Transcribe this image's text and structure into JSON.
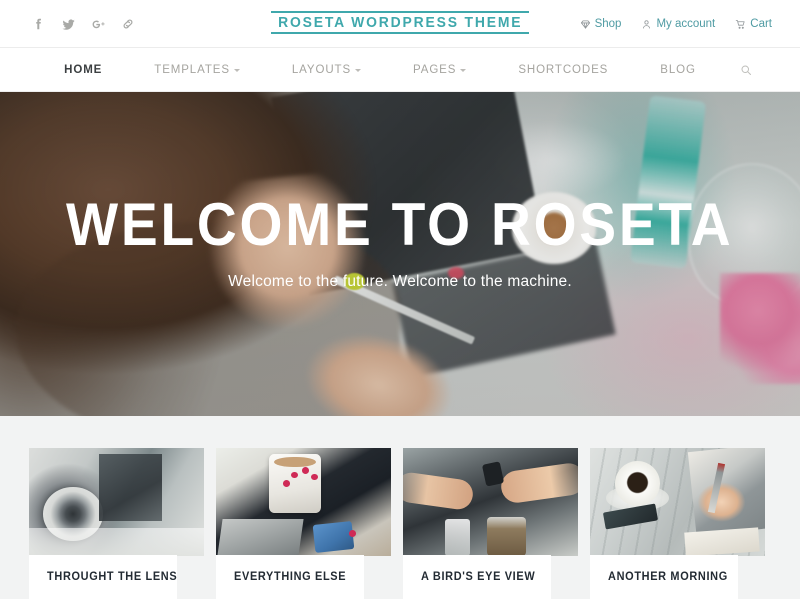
{
  "topbar": {
    "social": [
      {
        "name": "facebook-icon",
        "label": "Facebook"
      },
      {
        "name": "twitter-icon",
        "label": "Twitter"
      },
      {
        "name": "google-plus-icon",
        "label": "Google Plus"
      },
      {
        "name": "link-icon",
        "label": "Link"
      }
    ],
    "logo": "Roseta Wordpress Theme",
    "links": [
      {
        "icon": "gem-icon",
        "label": "Shop"
      },
      {
        "icon": "user-icon",
        "label": "My account"
      },
      {
        "icon": "cart-icon",
        "label": "Cart"
      }
    ],
    "accent_color": "#3fa8ac",
    "link_color": "#4f9ba3"
  },
  "nav": {
    "items": [
      {
        "label": "Home",
        "has_dropdown": false,
        "active": true
      },
      {
        "label": "Templates",
        "has_dropdown": true,
        "active": false
      },
      {
        "label": "Layouts",
        "has_dropdown": true,
        "active": false
      },
      {
        "label": "Pages",
        "has_dropdown": true,
        "active": false
      },
      {
        "label": "Shortcodes",
        "has_dropdown": false,
        "active": false
      },
      {
        "label": "Blog",
        "has_dropdown": false,
        "active": false
      }
    ],
    "search_icon": "search-icon",
    "active_color": "#3c4042",
    "inactive_color": "#a5a49f"
  },
  "hero": {
    "title": "Welcome to Roseta",
    "subtitle": "Welcome to the future. Welcome to the machine.",
    "text_color": "#ffffff"
  },
  "cards": [
    {
      "title": "Throught the Lens",
      "image": "desk-with-speaker-and-monitor"
    },
    {
      "title": "Everything Else",
      "image": "woman-holding-mug-at-laptop"
    },
    {
      "title": "A Bird's Eye View",
      "image": "fist-bump-over-table"
    },
    {
      "title": "Another Morning",
      "image": "coffee-cup-and-writing-hand"
    }
  ],
  "theme": {
    "page_background": "#ffffff",
    "section_background": "#f2f3f3",
    "card_title_color": "#232b33"
  }
}
